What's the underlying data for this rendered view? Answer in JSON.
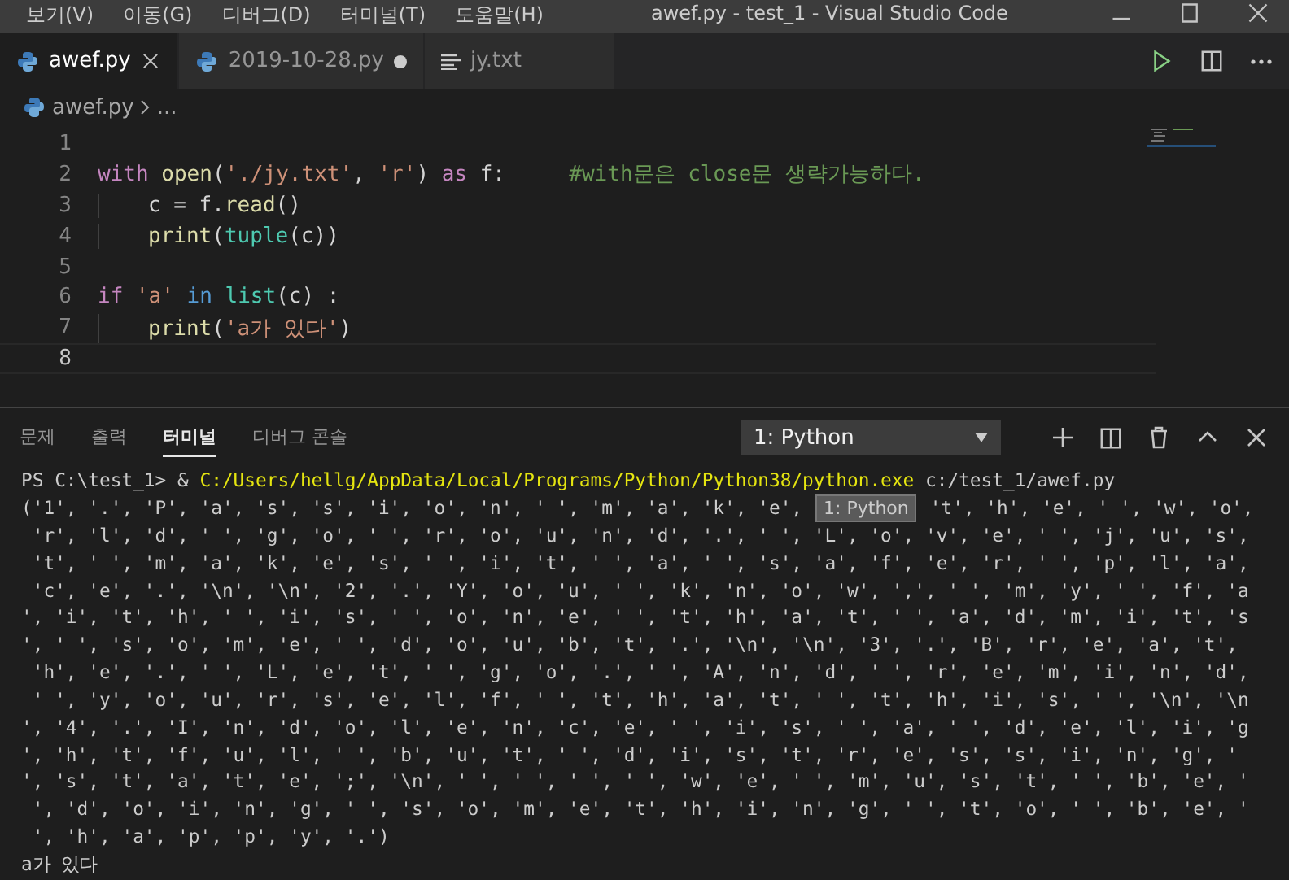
{
  "menu": [
    "보기(V)",
    "이동(G)",
    "디버그(D)",
    "터미널(T)",
    "도움말(H)"
  ],
  "window": {
    "title": "awef.py - test_1 - Visual Studio Code"
  },
  "tabs": [
    {
      "label": "awef.py",
      "kind": "python",
      "selected": true,
      "modified": false
    },
    {
      "label": "2019-10-28.py",
      "kind": "python",
      "selected": false,
      "modified": true
    },
    {
      "label": "jy.txt",
      "kind": "text",
      "selected": false,
      "modified": false
    }
  ],
  "breadcrumb": [
    "awef.py",
    "..."
  ],
  "editor": {
    "lines": [
      {
        "number": "1",
        "current": false
      },
      {
        "number": "2",
        "current": false,
        "tokens": [
          {
            "kind": "keyword",
            "text": "with"
          },
          {
            "kind": "function",
            "text": " open"
          },
          {
            "kind": "plain",
            "text": "("
          },
          {
            "kind": "string",
            "text": "'./jy.txt'"
          },
          {
            "kind": "plain",
            "text": ", "
          },
          {
            "kind": "string",
            "text": "'r'"
          },
          {
            "kind": "plain",
            "text": ") "
          },
          {
            "kind": "keyword",
            "text": "as"
          },
          {
            "kind": "plain",
            "text": " f:     "
          },
          {
            "kind": "comment",
            "text": "#with문은 close문 생략가능하다."
          }
        ],
        "children": [
          {
            "number": "3",
            "current": false,
            "tokens": [
              {
                "kind": "plain",
                "text": "c = f."
              },
              {
                "kind": "function",
                "text": "read"
              },
              {
                "kind": "plain",
                "text": "()"
              }
            ]
          },
          {
            "number": "4",
            "current": false,
            "tokens": [
              {
                "kind": "function",
                "text": "print"
              },
              {
                "kind": "plain",
                "text": "("
              },
              {
                "kind": "class",
                "text": "tuple"
              },
              {
                "kind": "plain",
                "text": "(c))"
              }
            ]
          }
        ]
      },
      {
        "number": "5",
        "current": false
      },
      {
        "number": "6",
        "current": false,
        "tokens": [
          {
            "kind": "keyword",
            "text": "if"
          },
          {
            "kind": "string",
            "text": " 'a'"
          },
          {
            "kind": "operator",
            "text": " in"
          },
          {
            "kind": "class",
            "text": " list"
          },
          {
            "kind": "plain",
            "text": "(c) :"
          }
        ],
        "children": [
          {
            "number": "7",
            "current": false,
            "tokens": [
              {
                "kind": "function",
                "text": "print"
              },
              {
                "kind": "plain",
                "text": "("
              },
              {
                "kind": "string",
                "text": "'a가 있다'"
              },
              {
                "kind": "plain",
                "text": ")"
              }
            ]
          }
        ]
      },
      {
        "number": "8",
        "current": true
      }
    ]
  },
  "panel": {
    "tabs": [
      {
        "label": "문제",
        "selected": false
      },
      {
        "label": "출력",
        "selected": false
      },
      {
        "label": "터미널",
        "selected": true
      },
      {
        "label": "디버그 콘솔",
        "selected": false
      }
    ],
    "terminal_select": "1: Python",
    "command": [
      {
        "kind": "plain",
        "text": "PS C:\\test_1> & "
      },
      {
        "kind": "path",
        "text": "C:/Users/hellg/AppData/Local/Programs/Python/Python38/python.exe"
      },
      {
        "kind": "plain",
        "text": " c:/test_1/awef.py"
      }
    ],
    "output": [
      {
        "kind": "covered",
        "before": "('1', '.', 'P', 'a', 's', 's', 'i', 'o', 'n', ' ', 'm', 'a', 'k', 'e',",
        "tooltip": "1: Python",
        "after": "'t', 'h', 'e', ' ', 'w', 'o',"
      },
      {
        "kind": "line",
        "text": " 'r', 'l', 'd', ' ', 'g', 'o', ' ', 'r', 'o', 'u', 'n', 'd', '.', ' ', 'L', 'o', 'v', 'e', ' ', 'j', 'u', 's',"
      },
      {
        "kind": "line",
        "text": " 't', ' ', 'm', 'a', 'k', 'e', 's', ' ', 'i', 't', ' ', 'a', ' ', 's', 'a', 'f', 'e', 'r', ' ', 'p', 'l', 'a',"
      },
      {
        "kind": "line",
        "text": " 'c', 'e', '.', '\\n', '\\n', '2', '.', 'Y', 'o', 'u', ' ', 'k', 'n', 'o', 'w', ',', ' ', 'm', 'y', ' ', 'f', 'a"
      },
      {
        "kind": "line",
        "text": "', 'i', 't', 'h', ' ', 'i', 's', ' ', 'o', 'n', 'e', ' ', 't', 'h', 'a', 't', ' ', 'a', 'd', 'm', 'i', 't', 's"
      },
      {
        "kind": "line",
        "text": "', ' ', 's', 'o', 'm', 'e', ' ', 'd', 'o', 'u', 'b', 't', '.', '\\n', '\\n', '3', '.', 'B', 'r', 'e', 'a', 't',"
      },
      {
        "kind": "line",
        "text": " 'h', 'e', '.', ' ', 'L', 'e', 't', ' ', 'g', 'o', '.', ' ', 'A', 'n', 'd', ' ', 'r', 'e', 'm', 'i', 'n', 'd',"
      },
      {
        "kind": "line",
        "text": " ' ', 'y', 'o', 'u', 'r', 's', 'e', 'l', 'f', ' ', 't', 'h', 'a', 't', ' ', 't', 'h', 'i', 's', ' ', '\\n', '\\n"
      },
      {
        "kind": "line",
        "text": "', '4', '.', 'I', 'n', 'd', 'o', 'l', 'e', 'n', 'c', 'e', ' ', 'i', 's', ' ', 'a', ' ', 'd', 'e', 'l', 'i', 'g"
      },
      {
        "kind": "line",
        "text": "', 'h', 't', 'f', 'u', 'l', ' ', 'b', 'u', 't', ' ', 'd', 'i', 's', 't', 'r', 'e', 's', 's', 'i', 'n', 'g', ' "
      },
      {
        "kind": "line",
        "text": "', 's', 't', 'a', 't', 'e', ';', '\\n', ' ', ' ', ' ', ' ', 'w', 'e', ' ', 'm', 'u', 's', 't', ' ', 'b', 'e', '"
      },
      {
        "kind": "line",
        "text": " ', 'd', 'o', 'i', 'n', 'g', ' ', 's', 'o', 'm', 'e', 't', 'h', 'i', 'n', 'g', ' ', 't', 'o', ' ', 'b', 'e', '"
      },
      {
        "kind": "line",
        "text": " ', 'h', 'a', 'p', 'p', 'y', '.')"
      },
      {
        "kind": "line",
        "text": "a가 있다"
      }
    ]
  }
}
